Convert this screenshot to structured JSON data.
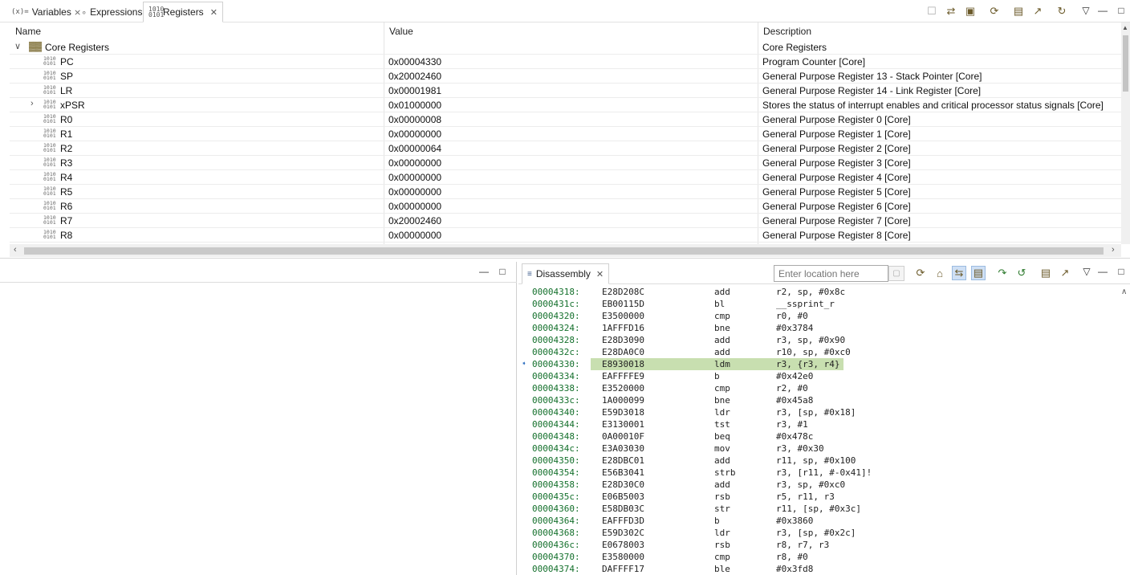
{
  "top_tabs": [
    {
      "label": "Variables",
      "icon": "(x)="
    },
    {
      "label": "Expressions",
      "icon": "expressions-icon"
    },
    {
      "label": "Registers",
      "icon": "1010 0101"
    }
  ],
  "registers": {
    "headers": {
      "name": "Name",
      "value": "Value",
      "description": "Description"
    },
    "group": {
      "name": "Core Registers",
      "description": "Core Registers"
    },
    "rows": [
      {
        "name": "PC",
        "value": "0x00004330",
        "description": "Program Counter [Core]"
      },
      {
        "name": "SP",
        "value": "0x20002460",
        "description": "General Purpose Register 13 - Stack Pointer [Core]"
      },
      {
        "name": "LR",
        "value": "0x00001981",
        "description": "General Purpose Register 14 - Link Register [Core]"
      },
      {
        "name": "xPSR",
        "value": "0x01000000",
        "description": "Stores the status of interrupt enables and critical processor status signals [Core]"
      },
      {
        "name": "R0",
        "value": "0x00000008",
        "description": "General Purpose Register 0 [Core]"
      },
      {
        "name": "R1",
        "value": "0x00000000",
        "description": "General Purpose Register 1 [Core]"
      },
      {
        "name": "R2",
        "value": "0x00000064",
        "description": "General Purpose Register 2 [Core]"
      },
      {
        "name": "R3",
        "value": "0x00000000",
        "description": "General Purpose Register 3 [Core]"
      },
      {
        "name": "R4",
        "value": "0x00000000",
        "description": "General Purpose Register 4 [Core]"
      },
      {
        "name": "R5",
        "value": "0x00000000",
        "description": "General Purpose Register 5 [Core]"
      },
      {
        "name": "R6",
        "value": "0x00000000",
        "description": "General Purpose Register 6 [Core]"
      },
      {
        "name": "R7",
        "value": "0x20002460",
        "description": "General Purpose Register 7 [Core]"
      },
      {
        "name": "R8",
        "value": "0x00000000",
        "description": "General Purpose Register 8 [Core]"
      }
    ]
  },
  "disassembly": {
    "tab_label": "Disassembly",
    "location_placeholder": "Enter location here",
    "current_address": "00004330:",
    "lines": [
      {
        "addr": "00004318:",
        "hex": "E28D208C",
        "mn": "add",
        "op": "r2, sp, #0x8c"
      },
      {
        "addr": "0000431c:",
        "hex": "EB00115D",
        "mn": "bl",
        "op": "__ssprint_r"
      },
      {
        "addr": "00004320:",
        "hex": "E3500000",
        "mn": "cmp",
        "op": "r0, #0"
      },
      {
        "addr": "00004324:",
        "hex": "1AFFFD16",
        "mn": "bne",
        "op": "#0x3784"
      },
      {
        "addr": "00004328:",
        "hex": "E28D3090",
        "mn": "add",
        "op": "r3, sp, #0x90"
      },
      {
        "addr": "0000432c:",
        "hex": "E28DA0C0",
        "mn": "add",
        "op": "r10, sp, #0xc0"
      },
      {
        "addr": "00004330:",
        "hex": "E8930018",
        "mn": "ldm",
        "op": "r3, {r3, r4}"
      },
      {
        "addr": "00004334:",
        "hex": "EAFFFFE9",
        "mn": "b",
        "op": "#0x42e0"
      },
      {
        "addr": "00004338:",
        "hex": "E3520000",
        "mn": "cmp",
        "op": "r2, #0"
      },
      {
        "addr": "0000433c:",
        "hex": "1A000099",
        "mn": "bne",
        "op": "#0x45a8"
      },
      {
        "addr": "00004340:",
        "hex": "E59D3018",
        "mn": "ldr",
        "op": "r3, [sp, #0x18]"
      },
      {
        "addr": "00004344:",
        "hex": "E3130001",
        "mn": "tst",
        "op": "r3, #1"
      },
      {
        "addr": "00004348:",
        "hex": "0A00010F",
        "mn": "beq",
        "op": "#0x478c"
      },
      {
        "addr": "0000434c:",
        "hex": "E3A03030",
        "mn": "mov",
        "op": "r3, #0x30"
      },
      {
        "addr": "00004350:",
        "hex": "E28DBC01",
        "mn": "add",
        "op": "r11, sp, #0x100"
      },
      {
        "addr": "00004354:",
        "hex": "E56B3041",
        "mn": "strb",
        "op": "r3, [r11, #-0x41]!"
      },
      {
        "addr": "00004358:",
        "hex": "E28D30C0",
        "mn": "add",
        "op": "r3, sp, #0xc0"
      },
      {
        "addr": "0000435c:",
        "hex": "E06B5003",
        "mn": "rsb",
        "op": "r5, r11, r3"
      },
      {
        "addr": "00004360:",
        "hex": "E58DB03C",
        "mn": "str",
        "op": "r11, [sp, #0x3c]"
      },
      {
        "addr": "00004364:",
        "hex": "EAFFFD3D",
        "mn": "b",
        "op": "#0x3860"
      },
      {
        "addr": "00004368:",
        "hex": "E59D302C",
        "mn": "ldr",
        "op": "r3, [sp, #0x2c]"
      },
      {
        "addr": "0000436c:",
        "hex": "E0678003",
        "mn": "rsb",
        "op": "r8, r7, r3"
      },
      {
        "addr": "00004370:",
        "hex": "E3580000",
        "mn": "cmp",
        "op": "r8, #0"
      },
      {
        "addr": "00004374:",
        "hex": "DAFFFF17",
        "mn": "ble",
        "op": "#0x3fd8"
      }
    ]
  },
  "colors": {
    "address_green": "#14702c",
    "current_line_highlight": "#c8dfb0"
  }
}
